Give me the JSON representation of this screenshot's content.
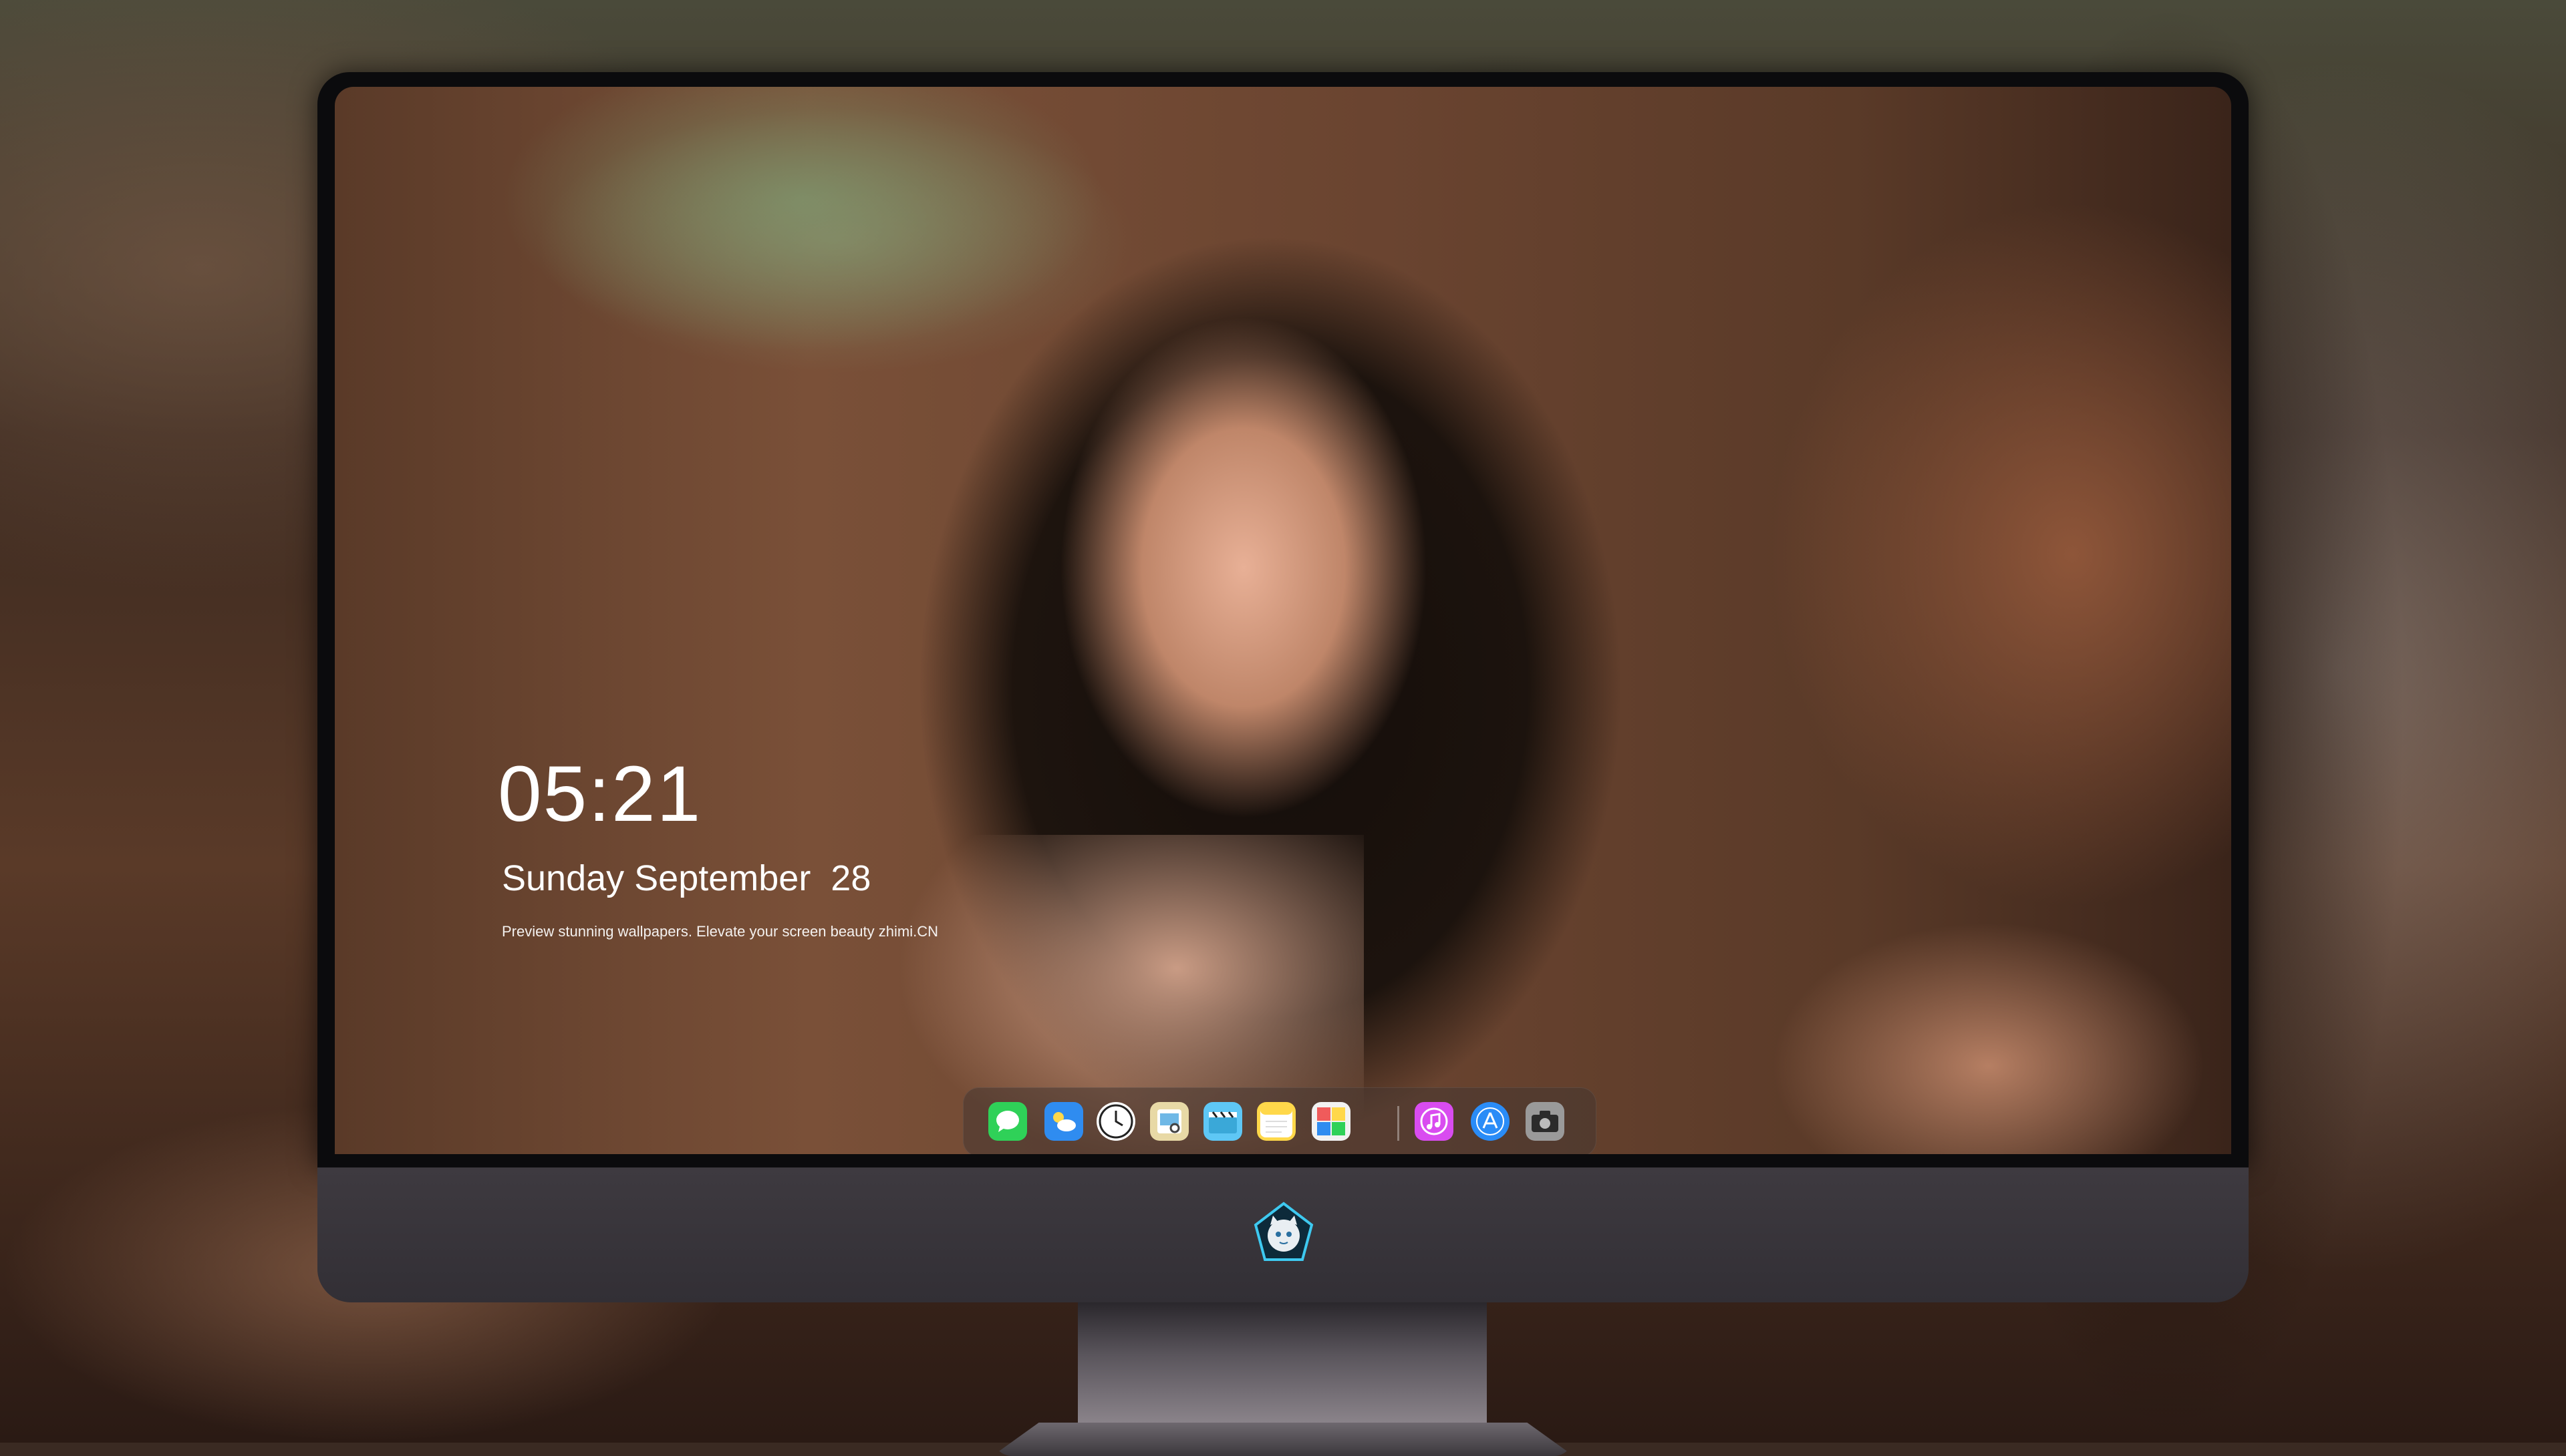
{
  "lock_screen": {
    "time": "05:21",
    "weekday_month": "Sunday September",
    "day": "28",
    "tagline": "Preview stunning wallpapers. Elevate your screen beauty zhimi.CN"
  },
  "dock": {
    "apps": [
      {
        "name": "Messages",
        "icon": "messages-icon",
        "color": "#2fd158"
      },
      {
        "name": "Weather",
        "icon": "weather-icon",
        "color": "#2f8cf0"
      },
      {
        "name": "Clock",
        "icon": "clock-icon",
        "color": "#ffffff"
      },
      {
        "name": "Preview",
        "icon": "preview-icon",
        "color": "#e8d9a6"
      },
      {
        "name": "Clips",
        "icon": "clapperboard-icon",
        "color": "#5ec7f5"
      },
      {
        "name": "Notes",
        "icon": "notes-icon",
        "color": "#ffd84a"
      },
      {
        "name": "Photos",
        "icon": "photos-icon",
        "color": "#f05b5b"
      },
      {
        "name": "Music",
        "icon": "music-icon",
        "color": "#d94cf0"
      },
      {
        "name": "App Store",
        "icon": "app-store-icon",
        "color": "#2a8cf7"
      },
      {
        "name": "Camera",
        "icon": "camera-icon",
        "color": "#9a9a9a"
      }
    ]
  },
  "monitor": {
    "logo_icon": "cat-mascot-logo-icon"
  }
}
